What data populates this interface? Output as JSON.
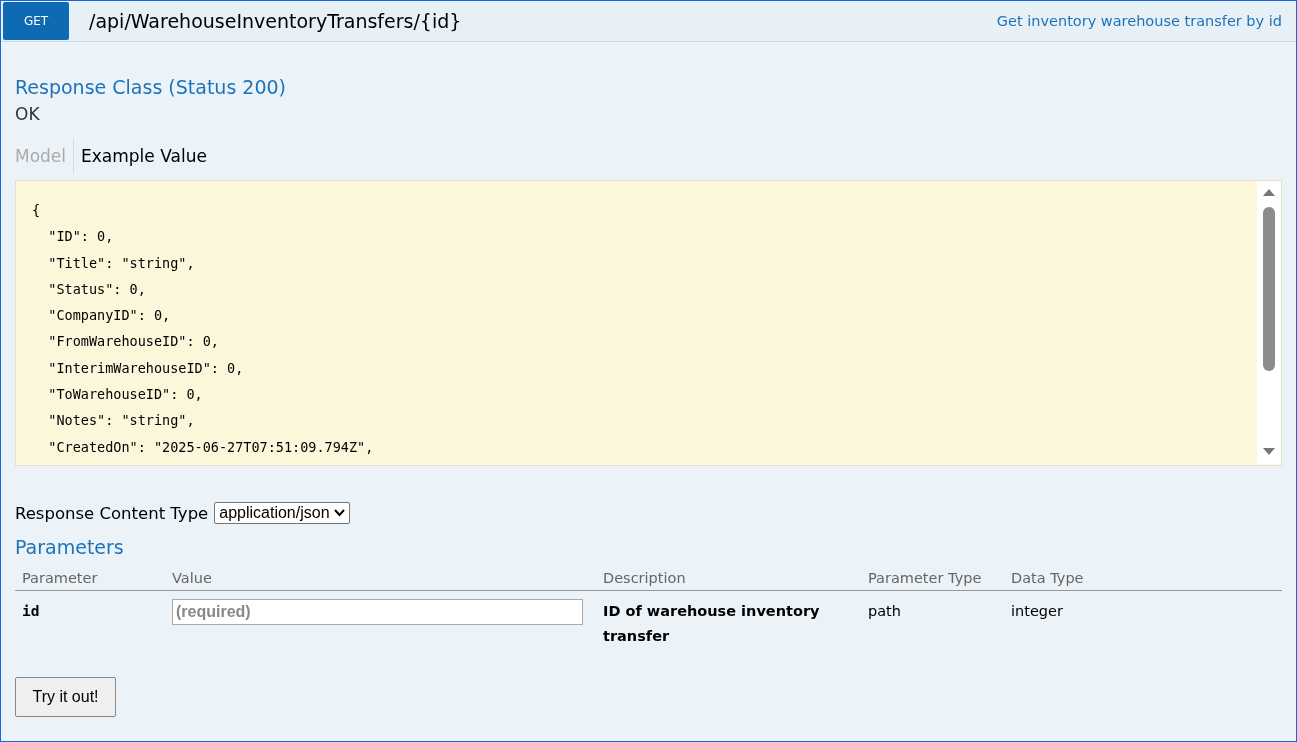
{
  "endpoint": {
    "method": "GET",
    "path": "/api/WarehouseInventoryTransfers/{id}",
    "summary": "Get inventory warehouse transfer by id"
  },
  "response_class": {
    "title": "Response Class (Status 200)",
    "text": "OK"
  },
  "tabs": [
    {
      "label": "Model",
      "selected": false
    },
    {
      "label": "Example Value",
      "selected": true
    }
  ],
  "example_lines": [
    "{",
    "  \"ID\": 0,",
    "  \"Title\": \"string\",",
    "  \"Status\": 0,",
    "  \"CompanyID\": 0,",
    "  \"FromWarehouseID\": 0,",
    "  \"InterimWarehouseID\": 0,",
    "  \"ToWarehouseID\": 0,",
    "  \"Notes\": \"string\",",
    "  \"CreatedOn\": \"2025-06-27T07:51:09.794Z\","
  ],
  "content_type": {
    "label": "Response Content Type",
    "value": "application/json"
  },
  "parameters": {
    "title": "Parameters",
    "columns": [
      "Parameter",
      "Value",
      "Description",
      "Parameter Type",
      "Data Type"
    ],
    "rows": [
      {
        "name": "id",
        "placeholder": "(required)",
        "description": "ID of warehouse inventory transfer",
        "parameter_type": "path",
        "data_type": "integer"
      }
    ]
  },
  "button": "Try it out!"
}
